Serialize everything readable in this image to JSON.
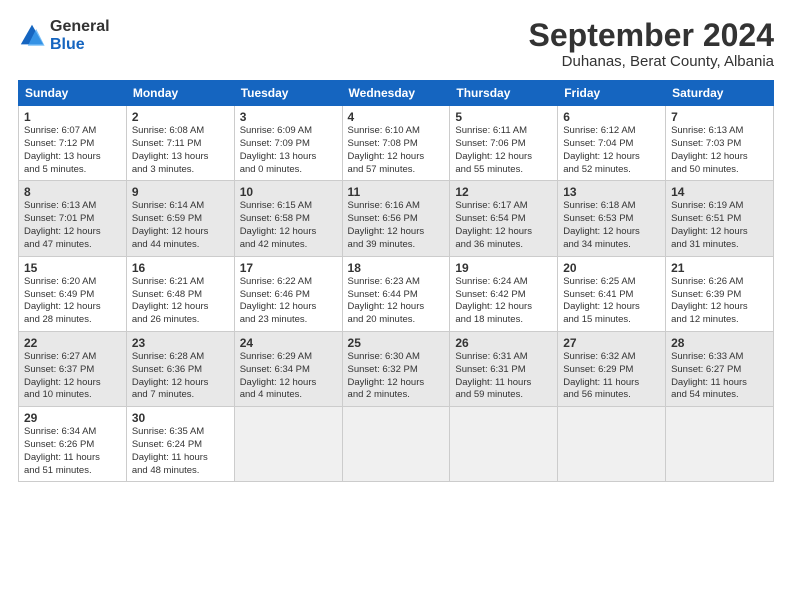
{
  "logo": {
    "general": "General",
    "blue": "Blue"
  },
  "title": "September 2024",
  "subtitle": "Duhanas, Berat County, Albania",
  "headers": [
    "Sunday",
    "Monday",
    "Tuesday",
    "Wednesday",
    "Thursday",
    "Friday",
    "Saturday"
  ],
  "weeks": [
    [
      {
        "num": "1",
        "info": "Sunrise: 6:07 AM\nSunset: 7:12 PM\nDaylight: 13 hours\nand 5 minutes."
      },
      {
        "num": "2",
        "info": "Sunrise: 6:08 AM\nSunset: 7:11 PM\nDaylight: 13 hours\nand 3 minutes."
      },
      {
        "num": "3",
        "info": "Sunrise: 6:09 AM\nSunset: 7:09 PM\nDaylight: 13 hours\nand 0 minutes."
      },
      {
        "num": "4",
        "info": "Sunrise: 6:10 AM\nSunset: 7:08 PM\nDaylight: 12 hours\nand 57 minutes."
      },
      {
        "num": "5",
        "info": "Sunrise: 6:11 AM\nSunset: 7:06 PM\nDaylight: 12 hours\nand 55 minutes."
      },
      {
        "num": "6",
        "info": "Sunrise: 6:12 AM\nSunset: 7:04 PM\nDaylight: 12 hours\nand 52 minutes."
      },
      {
        "num": "7",
        "info": "Sunrise: 6:13 AM\nSunset: 7:03 PM\nDaylight: 12 hours\nand 50 minutes."
      }
    ],
    [
      {
        "num": "8",
        "info": "Sunrise: 6:13 AM\nSunset: 7:01 PM\nDaylight: 12 hours\nand 47 minutes."
      },
      {
        "num": "9",
        "info": "Sunrise: 6:14 AM\nSunset: 6:59 PM\nDaylight: 12 hours\nand 44 minutes."
      },
      {
        "num": "10",
        "info": "Sunrise: 6:15 AM\nSunset: 6:58 PM\nDaylight: 12 hours\nand 42 minutes."
      },
      {
        "num": "11",
        "info": "Sunrise: 6:16 AM\nSunset: 6:56 PM\nDaylight: 12 hours\nand 39 minutes."
      },
      {
        "num": "12",
        "info": "Sunrise: 6:17 AM\nSunset: 6:54 PM\nDaylight: 12 hours\nand 36 minutes."
      },
      {
        "num": "13",
        "info": "Sunrise: 6:18 AM\nSunset: 6:53 PM\nDaylight: 12 hours\nand 34 minutes."
      },
      {
        "num": "14",
        "info": "Sunrise: 6:19 AM\nSunset: 6:51 PM\nDaylight: 12 hours\nand 31 minutes."
      }
    ],
    [
      {
        "num": "15",
        "info": "Sunrise: 6:20 AM\nSunset: 6:49 PM\nDaylight: 12 hours\nand 28 minutes."
      },
      {
        "num": "16",
        "info": "Sunrise: 6:21 AM\nSunset: 6:48 PM\nDaylight: 12 hours\nand 26 minutes."
      },
      {
        "num": "17",
        "info": "Sunrise: 6:22 AM\nSunset: 6:46 PM\nDaylight: 12 hours\nand 23 minutes."
      },
      {
        "num": "18",
        "info": "Sunrise: 6:23 AM\nSunset: 6:44 PM\nDaylight: 12 hours\nand 20 minutes."
      },
      {
        "num": "19",
        "info": "Sunrise: 6:24 AM\nSunset: 6:42 PM\nDaylight: 12 hours\nand 18 minutes."
      },
      {
        "num": "20",
        "info": "Sunrise: 6:25 AM\nSunset: 6:41 PM\nDaylight: 12 hours\nand 15 minutes."
      },
      {
        "num": "21",
        "info": "Sunrise: 6:26 AM\nSunset: 6:39 PM\nDaylight: 12 hours\nand 12 minutes."
      }
    ],
    [
      {
        "num": "22",
        "info": "Sunrise: 6:27 AM\nSunset: 6:37 PM\nDaylight: 12 hours\nand 10 minutes."
      },
      {
        "num": "23",
        "info": "Sunrise: 6:28 AM\nSunset: 6:36 PM\nDaylight: 12 hours\nand 7 minutes."
      },
      {
        "num": "24",
        "info": "Sunrise: 6:29 AM\nSunset: 6:34 PM\nDaylight: 12 hours\nand 4 minutes."
      },
      {
        "num": "25",
        "info": "Sunrise: 6:30 AM\nSunset: 6:32 PM\nDaylight: 12 hours\nand 2 minutes."
      },
      {
        "num": "26",
        "info": "Sunrise: 6:31 AM\nSunset: 6:31 PM\nDaylight: 11 hours\nand 59 minutes."
      },
      {
        "num": "27",
        "info": "Sunrise: 6:32 AM\nSunset: 6:29 PM\nDaylight: 11 hours\nand 56 minutes."
      },
      {
        "num": "28",
        "info": "Sunrise: 6:33 AM\nSunset: 6:27 PM\nDaylight: 11 hours\nand 54 minutes."
      }
    ],
    [
      {
        "num": "29",
        "info": "Sunrise: 6:34 AM\nSunset: 6:26 PM\nDaylight: 11 hours\nand 51 minutes."
      },
      {
        "num": "30",
        "info": "Sunrise: 6:35 AM\nSunset: 6:24 PM\nDaylight: 11 hours\nand 48 minutes."
      },
      {
        "num": "",
        "info": ""
      },
      {
        "num": "",
        "info": ""
      },
      {
        "num": "",
        "info": ""
      },
      {
        "num": "",
        "info": ""
      },
      {
        "num": "",
        "info": ""
      }
    ]
  ]
}
